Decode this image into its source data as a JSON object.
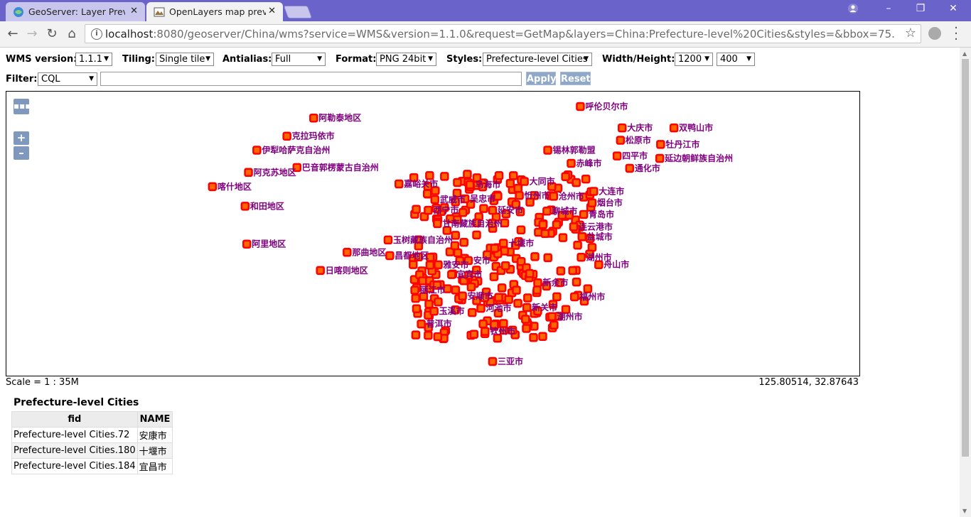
{
  "browser": {
    "tabs": [
      {
        "title": "GeoServer: Layer Previe",
        "close": "✕"
      },
      {
        "title": "OpenLayers map previe",
        "close": "✕"
      }
    ],
    "url_host": "localhost",
    "url_rest": ":8080/geoserver/China/wms?service=WMS&version=1.1.0&request=GetMap&layers=China:Prefecture-level%20Cities&styles=&bbox=75.986688015,18.25…"
  },
  "controls": {
    "wms_version_label": "WMS version:",
    "wms_version": "1.1.1",
    "tiling_label": "Tiling:",
    "tiling": "Single tile",
    "antialias_label": "Antialias:",
    "antialias": "Full",
    "format_label": "Format:",
    "format": "PNG 24bit",
    "styles_label": "Styles:",
    "styles": "Prefecture-level Cities",
    "size_label": "Width/Height:",
    "width": "1200",
    "height": "400",
    "filter_label": "Filter:",
    "filter_type": "CQL",
    "filter_value": "",
    "apply_label": "Apply",
    "reset_label": "Reset"
  },
  "map": {
    "point_color": "#ff0000",
    "point_border": "#ff6600",
    "label_color": "#800080",
    "labels": [
      {
        "text": "呼伦贝尔市",
        "lon": 120.0,
        "lat": 49.2
      },
      {
        "text": "阿勒泰地区",
        "lon": 88.1,
        "lat": 47.8
      },
      {
        "text": "克拉玛依市",
        "lon": 84.9,
        "lat": 45.6
      },
      {
        "text": "大庆市",
        "lon": 125.0,
        "lat": 46.6
      },
      {
        "text": "双鸭山市",
        "lon": 131.2,
        "lat": 46.6
      },
      {
        "text": "伊犁哈萨克自治州",
        "lon": 81.3,
        "lat": 43.9
      },
      {
        "text": "松原市",
        "lon": 124.8,
        "lat": 45.1
      },
      {
        "text": "牡丹江市",
        "lon": 129.6,
        "lat": 44.6
      },
      {
        "text": "锡林郭勒盟",
        "lon": 116.1,
        "lat": 43.9
      },
      {
        "text": "四平市",
        "lon": 124.4,
        "lat": 43.2
      },
      {
        "text": "延边朝鲜族自治州",
        "lon": 129.5,
        "lat": 42.9
      },
      {
        "text": "巴音郭楞蒙古自治州",
        "lon": 86.1,
        "lat": 41.8
      },
      {
        "text": "赤峰市",
        "lon": 118.9,
        "lat": 42.3
      },
      {
        "text": "通化市",
        "lon": 125.9,
        "lat": 41.7
      },
      {
        "text": "阿克苏地区",
        "lon": 80.3,
        "lat": 41.2
      },
      {
        "text": "嘉峪关市",
        "lon": 98.3,
        "lat": 39.8
      },
      {
        "text": "乌海市",
        "lon": 106.8,
        "lat": 39.7
      },
      {
        "text": "大同市",
        "lon": 113.3,
        "lat": 40.1
      },
      {
        "text": "喀什地区",
        "lon": 75.99,
        "lat": 39.47
      },
      {
        "text": "大连市",
        "lon": 121.6,
        "lat": 38.9
      },
      {
        "text": "忻州市",
        "lon": 112.7,
        "lat": 38.4
      },
      {
        "text": "沧州市",
        "lon": 116.8,
        "lat": 38.3
      },
      {
        "text": "武威市",
        "lon": 102.6,
        "lat": 37.9
      },
      {
        "text": "吴忠市",
        "lon": 106.2,
        "lat": 37.99
      },
      {
        "text": "烟台市",
        "lon": 121.4,
        "lat": 37.5
      },
      {
        "text": "和田地区",
        "lon": 79.9,
        "lat": 37.1
      },
      {
        "text": "西宁市",
        "lon": 101.8,
        "lat": 36.6
      },
      {
        "text": "延安市",
        "lon": 109.5,
        "lat": 36.6
      },
      {
        "text": "聊城市",
        "lon": 116.0,
        "lat": 36.5
      },
      {
        "text": "青岛市",
        "lon": 120.4,
        "lat": 36.1
      },
      {
        "text": "甘南藏族自治州",
        "lon": 102.9,
        "lat": 34.98
      },
      {
        "text": "连云港市",
        "lon": 119.2,
        "lat": 34.6
      },
      {
        "text": "玉树藏族自治州",
        "lon": 97.0,
        "lat": 33.0
      },
      {
        "text": "十堰市",
        "lon": 110.8,
        "lat": 32.6
      },
      {
        "text": "盐城市",
        "lon": 120.2,
        "lat": 33.4
      },
      {
        "text": "阿里地区",
        "lon": 80.1,
        "lat": 32.5
      },
      {
        "text": "那曲地区",
        "lon": 92.1,
        "lat": 31.5
      },
      {
        "text": "昌都地区",
        "lon": 97.2,
        "lat": 31.1
      },
      {
        "text": "雅安市",
        "lon": 103.0,
        "lat": 29.98
      },
      {
        "text": "安市",
        "lon": 106.6,
        "lat": 30.5
      },
      {
        "text": "湖州市",
        "lon": 120.1,
        "lat": 30.9
      },
      {
        "text": "舟山市",
        "lon": 122.2,
        "lat": 30.0
      },
      {
        "text": "日喀则地区",
        "lon": 88.9,
        "lat": 29.3
      },
      {
        "text": "宜宾市",
        "lon": 104.6,
        "lat": 28.8
      },
      {
        "text": "新余市",
        "lon": 114.9,
        "lat": 27.8
      },
      {
        "text": "福州市",
        "lon": 119.3,
        "lat": 26.1
      },
      {
        "text": "丽江市",
        "lon": 100.2,
        "lat": 26.9
      },
      {
        "text": "安顺市",
        "lon": 105.9,
        "lat": 26.2
      },
      {
        "text": "河池市",
        "lon": 108.1,
        "lat": 24.7
      },
      {
        "text": "新关市",
        "lon": 113.6,
        "lat": 24.8
      },
      {
        "text": "潮州市",
        "lon": 116.6,
        "lat": 23.7
      },
      {
        "text": "玉溪市",
        "lon": 102.5,
        "lat": 24.35
      },
      {
        "text": "普洱市",
        "lon": 100.97,
        "lat": 22.8
      },
      {
        "text": "钦州市",
        "lon": 108.6,
        "lat": 21.9
      },
      {
        "text": "三亚市",
        "lon": 109.5,
        "lat": 18.25
      }
    ]
  },
  "map_controls": {
    "toggle": "▪▪▪",
    "zoom_in": "+",
    "zoom_out": "–"
  },
  "scale_text": "Scale = 1 : 35M",
  "coords_text": "125.80514, 32.87643",
  "results": {
    "title": "Prefecture-level Cities",
    "headers": [
      "fid",
      "NAME"
    ],
    "rows": [
      {
        "fid": "Prefecture-level Cities.72",
        "name": "安康市"
      },
      {
        "fid": "Prefecture-level Cities.180",
        "name": "十堰市"
      },
      {
        "fid": "Prefecture-level Cities.184",
        "name": "宜昌市"
      }
    ]
  }
}
